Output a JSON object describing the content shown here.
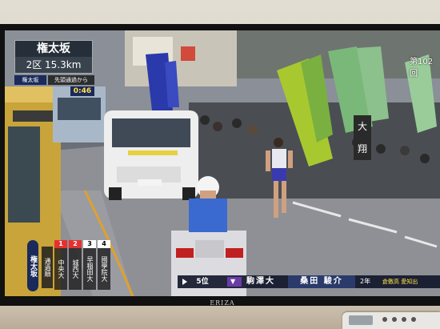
{
  "scene": {
    "location_name": "権太坂",
    "distance": "2区 15.3km",
    "pass_tag": "権太坂",
    "pass_label": "先頭通過から",
    "pass_time": "0:46",
    "edition": "第102回",
    "vertical_location": "権太坂",
    "vertical_sub": "通過順",
    "ranks": [
      {
        "num": "1",
        "school": "中央大",
        "color": "#e53030"
      },
      {
        "num": "2",
        "school": "城西大",
        "color": "#e53030"
      },
      {
        "num": "3",
        "school": "早稲田大",
        "color": "#ffffff"
      },
      {
        "num": "4",
        "school": "國學院大",
        "color": "#ffffff"
      }
    ],
    "position": "5位",
    "university": "駒澤大",
    "runner": "桑田 駿介",
    "grade": "2年",
    "high_school": "倉敷高 愛知出",
    "tv_brand": "ERIZA",
    "banners": [
      "大",
      "翔"
    ]
  }
}
